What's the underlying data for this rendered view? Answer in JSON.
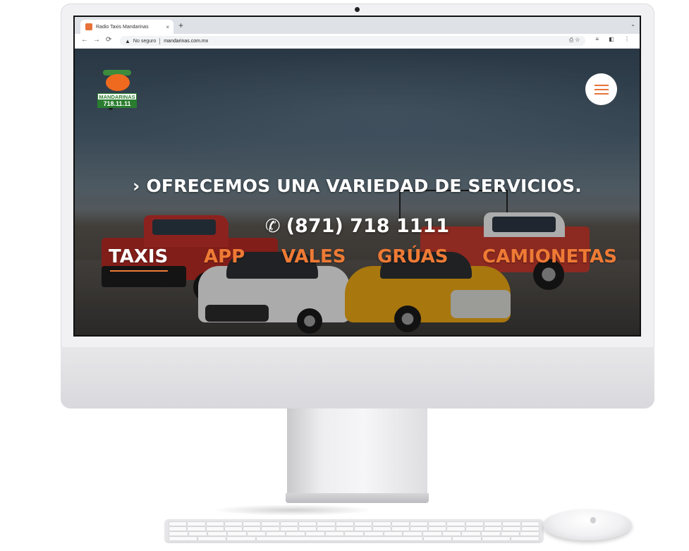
{
  "browser": {
    "tab_title": "Radio Taxis Mandarinas",
    "tab_close": "×",
    "new_tab": "+",
    "tab_dropdown": "⌄",
    "back": "←",
    "forward": "→",
    "reload": "⟳",
    "security_warning_icon": "▲",
    "security_label": "No seguro",
    "url": "mandarinas.com.mx",
    "omnibox_icons": "⎙ ☆",
    "toolbar_icons": "≡ ◧ ⋮"
  },
  "site": {
    "logo": {
      "name": "MANDARINAS",
      "number": "718.11.11"
    },
    "headline": "› OFRECEMOS UNA VARIEDAD DE SERVICIOS.",
    "phone_icon": "✆",
    "phone": "(871) 718 1111",
    "services": [
      {
        "label": "TAXIS",
        "active": true
      },
      {
        "label": "APP",
        "active": false
      },
      {
        "label": "VALES",
        "active": false
      },
      {
        "label": "GRÚAS",
        "active": false
      },
      {
        "label": "CAMIONETAS",
        "active": false
      }
    ]
  },
  "colors": {
    "accent": "#ee7a35",
    "logo_green": "#2a7d2f"
  }
}
